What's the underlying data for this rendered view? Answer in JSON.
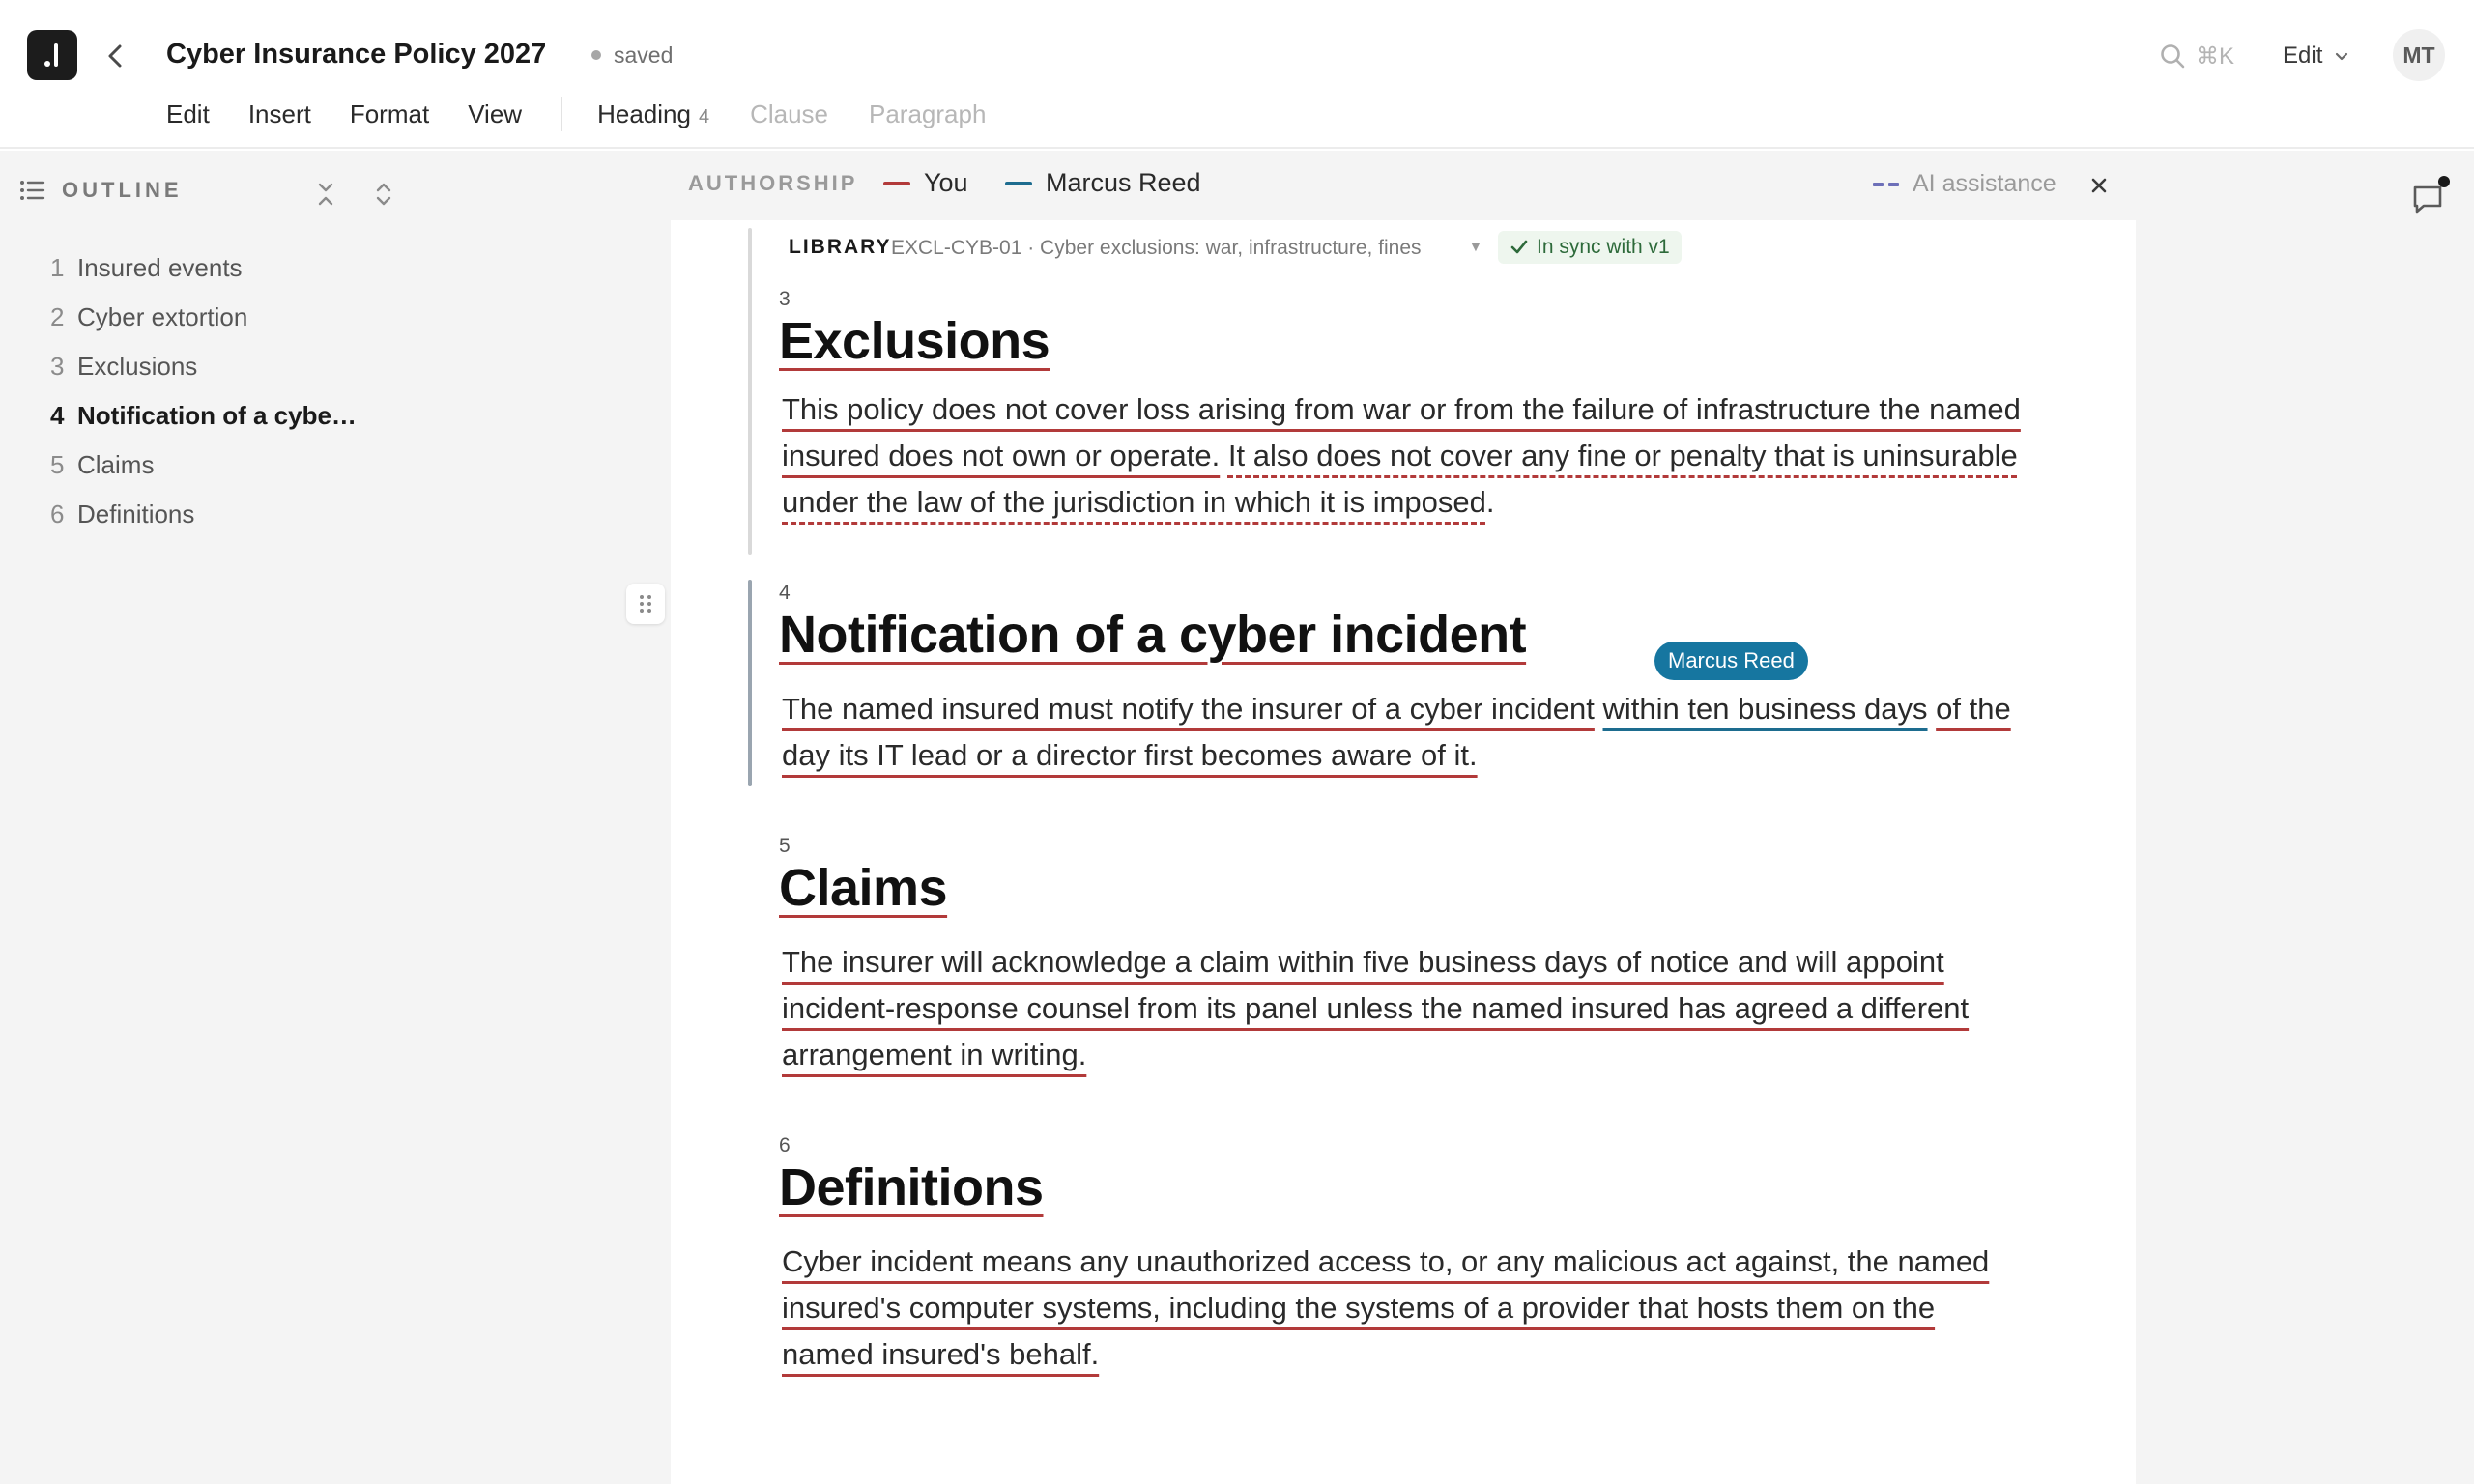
{
  "app": {
    "title": "Cyber Insurance Policy 2027",
    "save_status": "saved",
    "search_shortcut": "⌘K",
    "mode_label": "Edit",
    "avatar_initials": "MT",
    "icons": [
      "app-logo-icon",
      "back-arrow-icon",
      "search-icon",
      "chevron-down-icon",
      "outline-list-icon",
      "collapse-all-icon",
      "expand-all-icon",
      "drag-handle-icon",
      "close-icon",
      "comment-icon",
      "checkmark-icon"
    ]
  },
  "menubar": {
    "items": [
      "Edit",
      "Insert",
      "Format",
      "View"
    ],
    "block_types": [
      {
        "label": "Heading",
        "level": "4",
        "active": true
      },
      {
        "label": "Clause",
        "active": false
      },
      {
        "label": "Paragraph",
        "active": false
      }
    ]
  },
  "outline": {
    "title": "OUTLINE",
    "items": [
      {
        "num": "1",
        "label": "Insured events"
      },
      {
        "num": "2",
        "label": "Cyber extortion"
      },
      {
        "num": "3",
        "label": "Exclusions"
      },
      {
        "num": "4",
        "label": "Notification of a cybe…",
        "active": true
      },
      {
        "num": "5",
        "label": "Claims"
      },
      {
        "num": "6",
        "label": "Definitions"
      }
    ]
  },
  "authorship": {
    "label": "AUTHORSHIP",
    "you": "You",
    "collaborator": "Marcus Reed",
    "ai": "AI assistance",
    "colors": {
      "you": "#b23a3a",
      "collaborator": "#1d6c8f",
      "ai": "#6d6fb8"
    }
  },
  "library": {
    "label": "LIBRARY",
    "reference": "EXCL-CYB-01 · Cyber exclusions: war, infrastructure, fines",
    "status": "In sync with v1"
  },
  "sections": [
    {
      "num": "3",
      "heading": "Exclusions",
      "body_you": "This policy does not cover loss arising from war or from the failure of infrastructure the named insured does not own or operate.",
      "body_ai": "It also does not cover any fine or penalty that is uninsurable under the law of the jurisdiction in which it is imposed",
      "body_end": "."
    },
    {
      "num": "4",
      "heading": "Notification of a cyber incident",
      "body_you_a": "The named insured must notify the insurer of a cyber incident",
      "body_marcus": "within ten business days",
      "body_you_b": "of the day its IT lead or a director first becomes aware of it."
    },
    {
      "num": "5",
      "heading": "Claims",
      "body": "The insurer will acknowledge a claim within five business days of notice and will appoint incident-response counsel from its panel unless the named insured has agreed a different arrangement in writing."
    },
    {
      "num": "6",
      "heading": "Definitions",
      "body": "Cyber incident means any unauthorized access to, or any malicious act against, the named insured's computer systems, including the systems of a provider that hosts them on the named insured's behalf."
    }
  ],
  "presence": {
    "name": "Marcus Reed"
  }
}
